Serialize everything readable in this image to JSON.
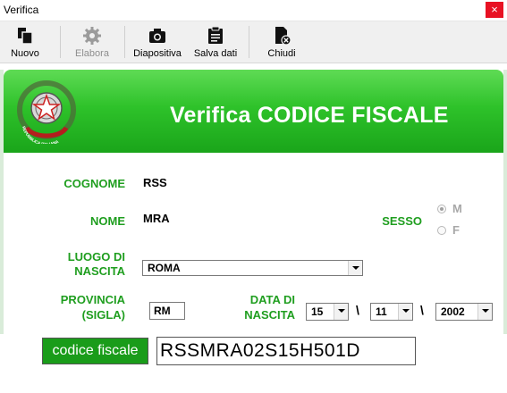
{
  "window": {
    "title": "Verifica",
    "close_glyph": "×"
  },
  "toolbar": {
    "items": [
      {
        "label": "Nuovo",
        "icon": "new-document-icon",
        "enabled": true
      },
      {
        "label": "Elabora",
        "icon": "gear-icon",
        "enabled": false
      },
      {
        "label": "Diapositiva",
        "icon": "camera-icon",
        "enabled": true
      },
      {
        "label": "Salva dati",
        "icon": "clipboard-icon",
        "enabled": true
      },
      {
        "label": "Chiudi",
        "icon": "close-document-icon",
        "enabled": true
      }
    ]
  },
  "banner": {
    "title": "Verifica CODICE FISCALE",
    "emblem_text": "REPUBBLICA ITALIANA"
  },
  "form": {
    "cognome_label": "COGNOME",
    "cognome_value": "RSS",
    "nome_label": "NOME",
    "nome_value": "MRA",
    "sesso_label": "SESSO",
    "sesso_options": [
      "M",
      "F"
    ],
    "sesso_selected": "M",
    "luogo_label_1": "LUOGO DI",
    "luogo_label_2": "NASCITA",
    "luogo_value": "ROMA",
    "provincia_label_1": "PROVINCIA",
    "provincia_label_2": "(SIGLA)",
    "provincia_value": "RM",
    "data_label_1": "DATA DI",
    "data_label_2": "NASCITA",
    "giorno": "15",
    "mese": "11",
    "anno": "2002",
    "date_separator": "\\"
  },
  "result": {
    "button_label": "codice fiscale",
    "value": "RSSMRA02S15H501D"
  },
  "colors": {
    "accent_green": "#1f9e1f",
    "banner_green": "#2ec22a",
    "close_red": "#e81123"
  }
}
